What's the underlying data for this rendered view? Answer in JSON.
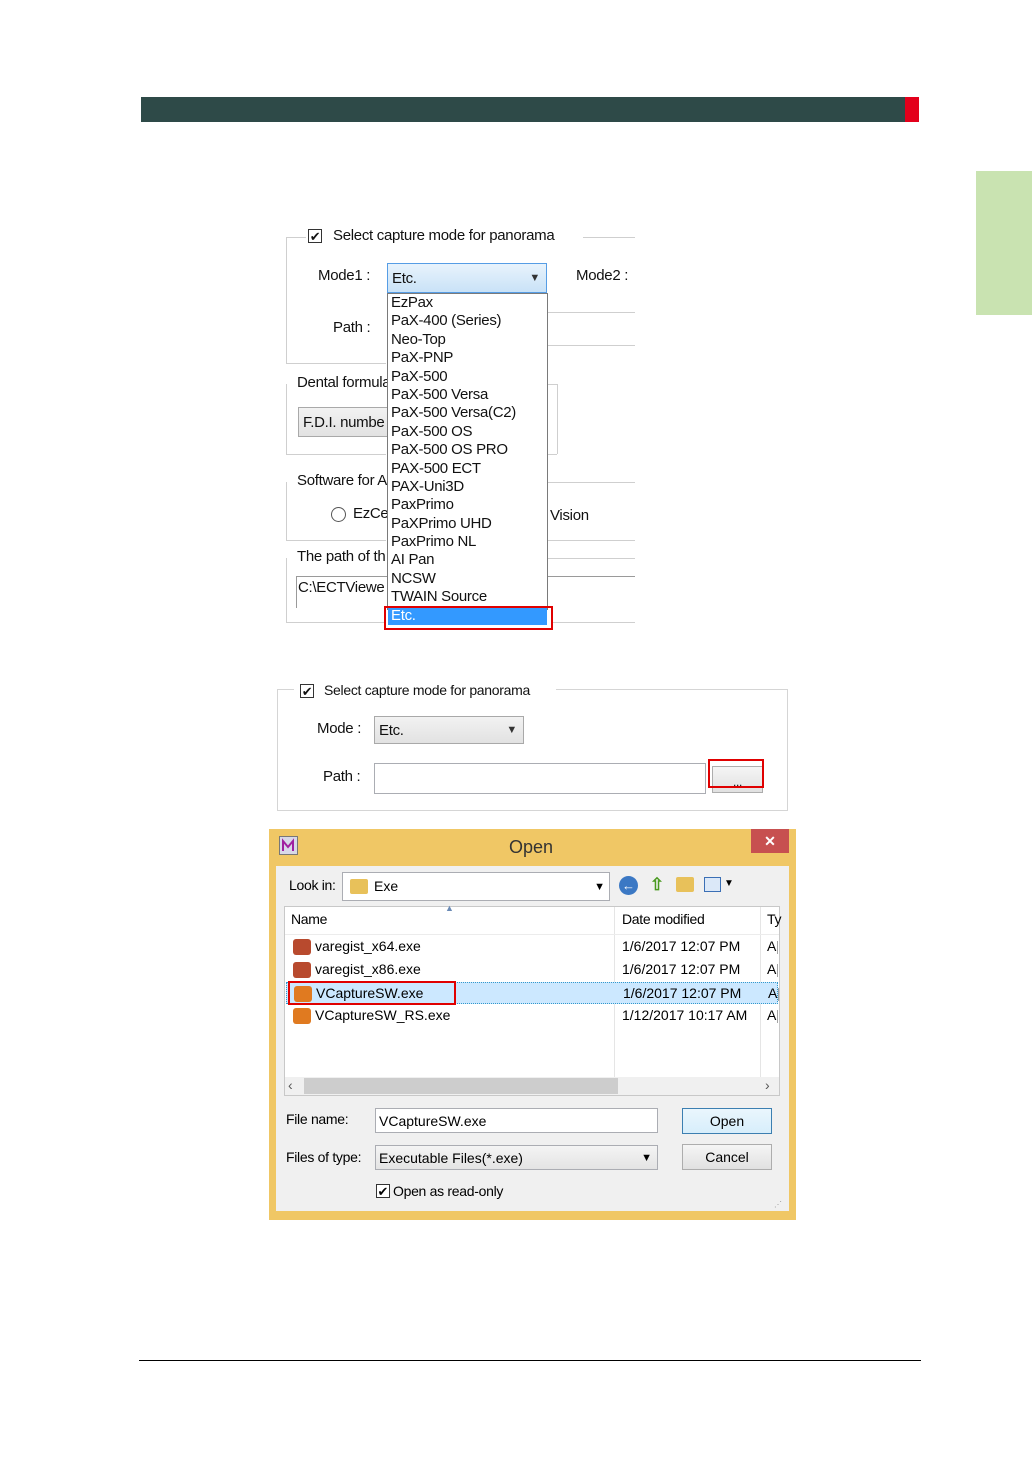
{
  "panel1": {
    "checkbox_label": "Select capture mode for panorama",
    "mode1_label": "Mode1 :",
    "mode1_value": "Etc.",
    "mode2_label": "Mode2 :",
    "path_label": "Path :",
    "dental_label": "Dental formula",
    "dental_value": "F.D.I. numbe",
    "software_label": "Software for A",
    "radio1_label": "EzCe",
    "radio2_suffix": "Vision",
    "path_of_label": "The path of th",
    "path_value": "C:\\ECTViewe",
    "dropdown_items": [
      "EzPax",
      "PaX-400 (Series)",
      "Neo-Top",
      "PaX-PNP",
      "PaX-500",
      "PaX-500 Versa",
      "PaX-500 Versa(C2)",
      "PaX-500 OS",
      "PaX-500 OS PRO",
      "PAX-500 ECT",
      "PAX-Uni3D",
      "PaxPrimo",
      "PaXPrimo UHD",
      "PaxPrimo NL",
      "AI Pan",
      "NCSW",
      "TWAIN Source",
      "Etc."
    ],
    "selected_item": "Etc."
  },
  "panel2": {
    "checkbox_label": "Select capture mode for panorama",
    "mode_label": "Mode :",
    "mode_value": "Etc.",
    "path_label": "Path :",
    "browse_label": "..."
  },
  "dialog": {
    "title": "Open",
    "close_glyph": "✕",
    "look_in_label": "Look in:",
    "look_in_value": "Exe",
    "col_name": "Name",
    "col_date": "Date modified",
    "col_type": "Ty",
    "rows": [
      {
        "name": "varegist_x64.exe",
        "date": "1/6/2017 12:07 PM",
        "type": "A|"
      },
      {
        "name": "varegist_x86.exe",
        "date": "1/6/2017 12:07 PM",
        "type": "A|"
      },
      {
        "name": "VCaptureSW.exe",
        "date": "1/6/2017 12:07 PM",
        "type": "A|"
      },
      {
        "name": "VCaptureSW_RS.exe",
        "date": "1/12/2017 10:17 AM",
        "type": "A|"
      }
    ],
    "file_name_label": "File name:",
    "file_name_value": "VCaptureSW.exe",
    "files_type_label": "Files of type:",
    "files_type_value": "Executable Files(*.exe)",
    "open_button": "Open",
    "cancel_button": "Cancel",
    "readonly_label": "Open as read-only"
  }
}
